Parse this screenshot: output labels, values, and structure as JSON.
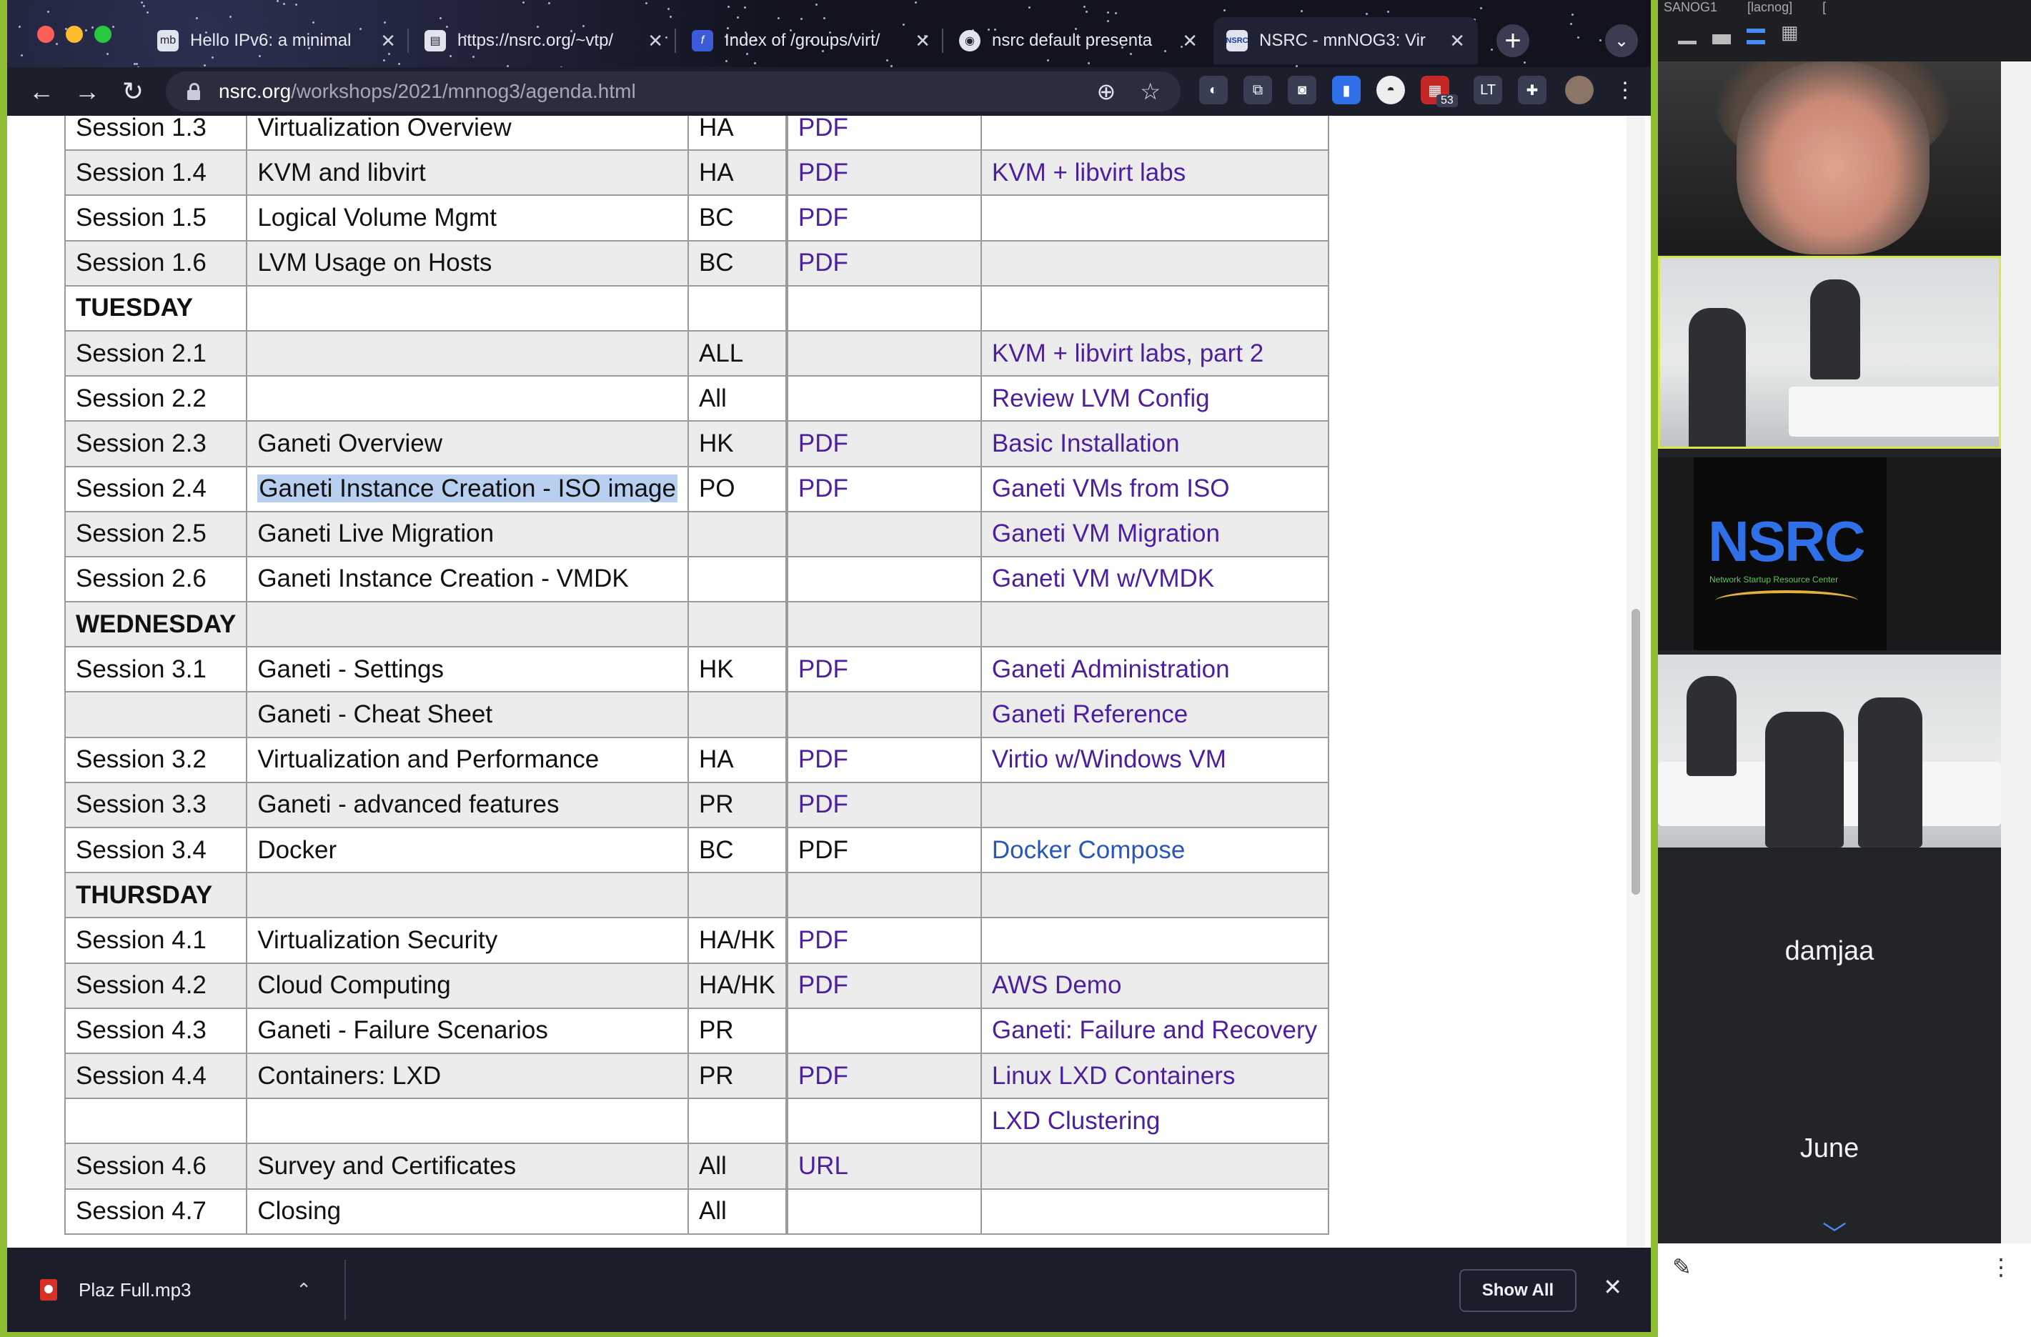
{
  "browser": {
    "tabs": [
      {
        "icon": "mb",
        "title": "Hello IPv6: a minimal",
        "active": false
      },
      {
        "icon": "book",
        "title": "https://nsrc.org/~vtp/",
        "active": false
      },
      {
        "icon": "f",
        "title": "Index of /groups/virt/",
        "active": false
      },
      {
        "icon": "globe",
        "title": "nsrc default presenta",
        "active": false
      },
      {
        "icon": "NSRC",
        "title": "NSRC - mnNOG3: Vir",
        "active": true
      }
    ],
    "address": {
      "domain": "nsrc.org",
      "path": "/workshops/2021/mnnog3/agenda.html"
    },
    "extension_badge": "53",
    "colors": {
      "window_border": "#8fbe35",
      "chrome": "#1c1e2c"
    }
  },
  "agenda": {
    "rows": [
      {
        "session": "Session 1.3",
        "topic": "Virtualization Overview",
        "who": "HA",
        "slides": "PDF",
        "lab": "",
        "type": "session"
      },
      {
        "session": "Session 1.4",
        "topic": "KVM and libvirt",
        "who": "HA",
        "slides": "PDF",
        "lab": "KVM + libvirt labs",
        "type": "session"
      },
      {
        "session": "Session 1.5",
        "topic": "Logical Volume Mgmt",
        "who": "BC",
        "slides": "PDF",
        "lab": "",
        "type": "session"
      },
      {
        "session": "Session 1.6",
        "topic": "LVM Usage on Hosts",
        "who": "BC",
        "slides": "PDF",
        "lab": "",
        "type": "session"
      },
      {
        "session": "TUESDAY",
        "topic": "",
        "who": "",
        "slides": "",
        "lab": "",
        "type": "day"
      },
      {
        "session": "Session 2.1",
        "topic": "",
        "who": "ALL",
        "slides": "",
        "lab": "KVM + libvirt labs, part 2",
        "type": "session"
      },
      {
        "session": "Session 2.2",
        "topic": "",
        "who": "All",
        "slides": "",
        "lab": "Review LVM Config",
        "type": "session"
      },
      {
        "session": "Session 2.3",
        "topic": "Ganeti Overview",
        "who": "HK",
        "slides": "PDF",
        "lab": "Basic Installation",
        "type": "session"
      },
      {
        "session": "Session 2.4",
        "topic": "Ganeti Instance Creation - ISO image",
        "who": "PO",
        "slides": "PDF",
        "lab": "Ganeti VMs from ISO",
        "type": "session",
        "highlight": true
      },
      {
        "session": "Session 2.5",
        "topic": "Ganeti Live Migration",
        "who": "",
        "slides": "",
        "lab": "Ganeti VM Migration",
        "type": "session"
      },
      {
        "session": "Session 2.6",
        "topic": "Ganeti Instance Creation - VMDK",
        "who": "",
        "slides": "",
        "lab": "Ganeti VM w/VMDK",
        "type": "session"
      },
      {
        "session": "WEDNESDAY",
        "topic": "",
        "who": "",
        "slides": "",
        "lab": "",
        "type": "day"
      },
      {
        "session": "Session 3.1",
        "topic": "Ganeti - Settings",
        "who": "HK",
        "slides": "PDF",
        "lab": "Ganeti Administration",
        "type": "session"
      },
      {
        "session": "",
        "topic": "Ganeti - Cheat Sheet",
        "who": "",
        "slides": "",
        "lab": "Ganeti Reference",
        "type": "session"
      },
      {
        "session": "Session 3.2",
        "topic": "Virtualization and Performance",
        "who": "HA",
        "slides": "PDF",
        "lab": "Virtio w/Windows VM",
        "type": "session"
      },
      {
        "session": "Session 3.3",
        "topic": "Ganeti - advanced features",
        "who": "PR",
        "slides": "PDF",
        "lab": "",
        "type": "session"
      },
      {
        "session": "Session 3.4",
        "topic": "Docker",
        "who": "BC",
        "slides": "PDF",
        "lab": "Docker Compose",
        "type": "session",
        "slides_plain": true,
        "lab_blue": true
      },
      {
        "session": "THURSDAY",
        "topic": "",
        "who": "",
        "slides": "",
        "lab": "",
        "type": "day"
      },
      {
        "session": "Session 4.1",
        "topic": "Virtualization Security",
        "who": "HA/HK",
        "slides": "PDF",
        "lab": "",
        "type": "session"
      },
      {
        "session": "Session 4.2",
        "topic": "Cloud Computing",
        "who": "HA/HK",
        "slides": "PDF",
        "lab": "AWS Demo",
        "type": "session"
      },
      {
        "session": "Session 4.3",
        "topic": "Ganeti - Failure Scenarios",
        "who": "PR",
        "slides": "",
        "lab": "Ganeti: Failure and Recovery",
        "type": "session"
      },
      {
        "session": "Session 4.4",
        "topic": "Containers: LXD",
        "who": "PR",
        "slides": "PDF",
        "lab": "Linux LXD Containers",
        "type": "session"
      },
      {
        "session": "",
        "topic": "",
        "who": "",
        "slides": "",
        "lab": "LXD Clustering",
        "type": "session"
      },
      {
        "session": "Session 4.6",
        "topic": "Survey and Certificates",
        "who": "All",
        "slides": "URL",
        "lab": "",
        "type": "session"
      },
      {
        "session": "Session 4.7",
        "topic": "Closing",
        "who": "All",
        "slides": "",
        "lab": "",
        "type": "session"
      }
    ]
  },
  "downloads": {
    "file": "Plaz Full.mp3",
    "show_all": "Show All"
  },
  "meeting": {
    "top_labels": [
      "SANOG1 ",
      "[lacnog] ",
      "[ "
    ],
    "tiles": [
      {
        "kind": "person"
      },
      {
        "kind": "room"
      },
      {
        "kind": "logo",
        "logo": "NSRC",
        "subtitle": "Network Startup Resource Center"
      },
      {
        "kind": "room"
      },
      {
        "kind": "name",
        "name": "damjaa"
      },
      {
        "kind": "name",
        "name": "June"
      }
    ]
  }
}
